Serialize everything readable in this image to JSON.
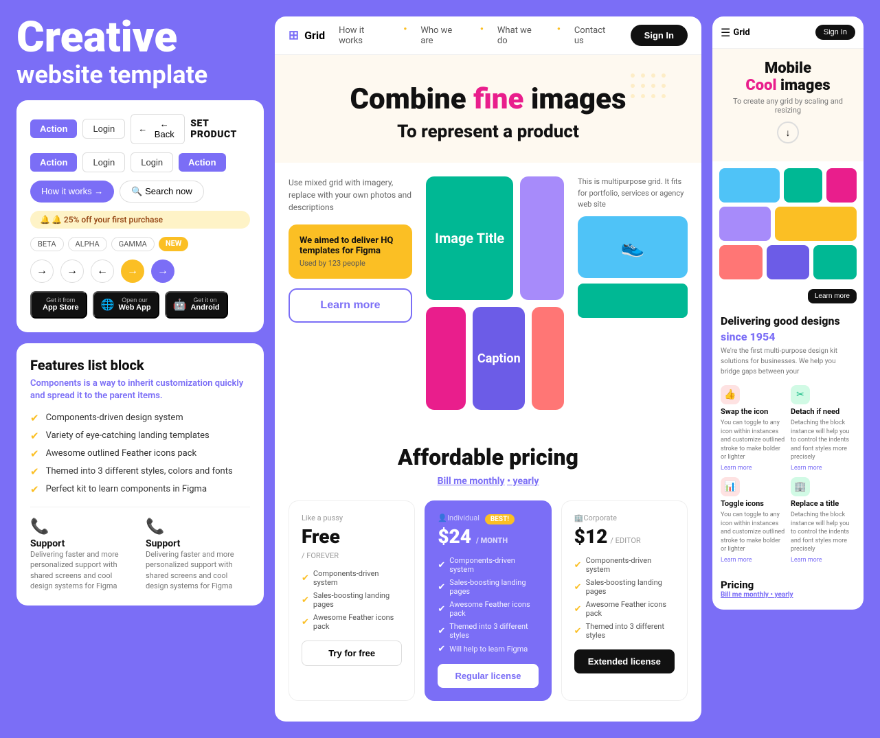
{
  "hero": {
    "title_line1": "Creative",
    "title_line2": "website template"
  },
  "components_card": {
    "btn1": "Action",
    "btn2": "Login",
    "btn3": "← Back",
    "btn4": "Action",
    "btn5": "Login",
    "btn6": "Login",
    "btn7": "Action",
    "how_it_works": "How it works →",
    "search_now": "🔍 Search now",
    "discount": "🔔 25% off your first purchase",
    "tags": [
      "BETA",
      "ALPHA",
      "GAMMA",
      "NEW"
    ],
    "app_store": "App Store",
    "web_app": "Web App",
    "android": "Android",
    "brand": "SET PRODUCT"
  },
  "features_card": {
    "title": "Features list block",
    "subtitle": "Components is a way to inherit customization quickly and spread it to the parent items.",
    "items": [
      "Components-driven design system",
      "Variety of eye-catching landing templates",
      "Awesome outlined Feather icons pack",
      "Themed into 3 different styles, colors and fonts",
      "Perfect kit to learn components in Figma"
    ],
    "support": {
      "title": "Support",
      "desc": "Delivering faster and more personalized support with shared screens and cool design systems for Figma"
    },
    "support2": {
      "title": "Support",
      "desc": "Delivering faster and more personalized support with shared screens and cool design systems for Figma"
    }
  },
  "middle": {
    "nav": {
      "brand": "Grid",
      "links": [
        "How it works",
        "Who we are",
        "What we do",
        "Contact us"
      ],
      "signin": "Sign In"
    },
    "hero": {
      "line1_pre": "Combine ",
      "line1_highlight": "fine",
      "line1_post": " images",
      "line2": "To represent a product"
    },
    "grid": {
      "left_text": "Use mixed grid with imagery, replace with your own photos and descriptions",
      "promo_text": "We aimed to deliver HQ templates for Figma",
      "promo_sub": "Used by 123 people",
      "right_text": "This is multipurpose grid. It fits for portfolio, services or agency web site",
      "image_title": "Image Title",
      "caption": "Caption",
      "learn_more": "Learn more"
    },
    "pricing": {
      "title": "Affordable pricing",
      "billing_pre": "Bill me ",
      "billing_toggle": "monthly",
      "billing_post": " • yearly",
      "plans": [
        {
          "label": "Like a pussy",
          "name": "Free",
          "period": "/ FOREVER",
          "features": [
            "Components-driven system",
            "Sales-boosting landing pages",
            "Awesome Feather icons pack"
          ],
          "btn": "Try for free",
          "btn_style": "outline"
        },
        {
          "label": "Individual",
          "name": "$24",
          "period": "/ MONTH",
          "best": "BEST!",
          "features": [
            "Components-driven system",
            "Sales-boosting landing pages",
            "Awesome Feather icons pack",
            "Themed into 3 different styles",
            "Will help to learn Figma"
          ],
          "btn": "Regular license",
          "btn_style": "dark"
        },
        {
          "label": "Corporate",
          "name": "$12",
          "period": "/ EDITOR",
          "features": [
            "Components-driven system",
            "Sales-boosting landing pages",
            "Awesome Feather icons pack",
            "Themed into 3 different styles"
          ],
          "btn": "Extended license",
          "btn_style": "outline"
        }
      ]
    }
  },
  "right": {
    "nav": {
      "brand": "Grid",
      "signin": "Sign In"
    },
    "hero": {
      "line1": "Mobile",
      "line2_pre": "",
      "line2_highlight": "Cool",
      "line2_post": " images",
      "desc": "To create any grid by scaling and resizing"
    },
    "learn_more": "Learn more",
    "section": {
      "title_pre": "Delivering good designs",
      "title_year": "since 1954",
      "desc": "We're the first multi-purpose design kit solutions for businesses. We help you bridge gaps between   your"
    },
    "features": [
      {
        "icon": "👍",
        "color": "rfi-red",
        "title": "Swap the icon",
        "desc": "You can toggle to any icon within instances and customize outlined stroke to make bolder or lighter",
        "link": "Learn more"
      },
      {
        "icon": "✂",
        "color": "rfi-green",
        "title": "Detach if need",
        "desc": "Detaching the block instance will help you to control the indents and font styles more precisely",
        "link": "Learn more"
      },
      {
        "icon": "📊",
        "color": "rfi-red",
        "title": "Toggle icons",
        "desc": "You can toggle to any icon within instances and customize outlined stroke to make bolder or lighter",
        "link": "Learn more"
      },
      {
        "icon": "🏢",
        "color": "rfi-green",
        "title": "Replace a title",
        "desc": "Detaching the block instance will help you to control the indents and font styles more precisely",
        "link": "Learn more"
      }
    ],
    "pricing": {
      "title": "Pricing",
      "billing_pre": "Bill me monthly • ",
      "billing_toggle": "yearly"
    }
  }
}
